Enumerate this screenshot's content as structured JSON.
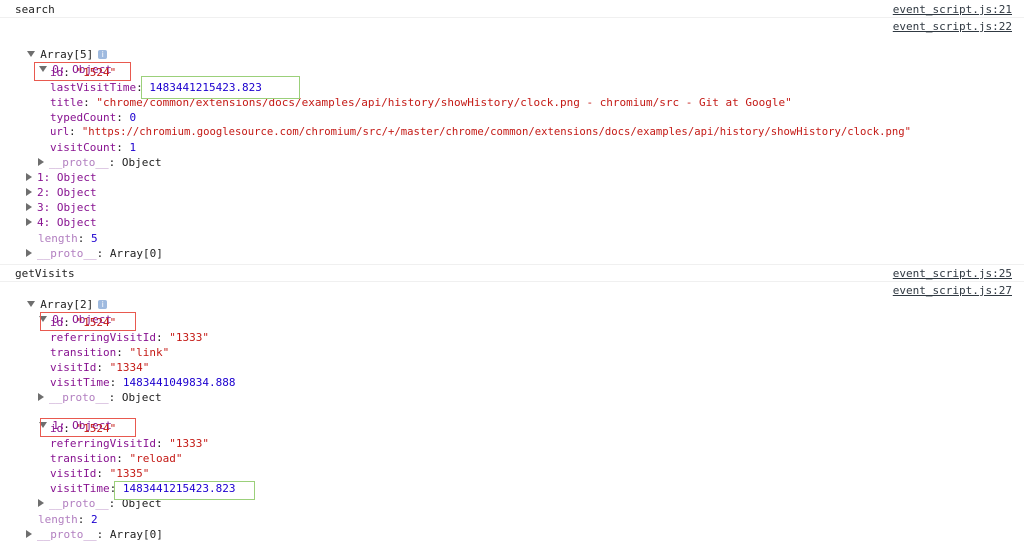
{
  "messages": [
    {
      "text": "search",
      "source": "event_script.js:21"
    },
    {
      "text": "getVisits",
      "source": "event_script.js:25"
    }
  ],
  "search_result": {
    "source": "event_script.js:22",
    "array_label": "Array[5]",
    "item0_label": "0: Object",
    "props": [
      {
        "key": "id",
        "value": "\"1524\"",
        "kind": "str"
      },
      {
        "key": "lastVisitTime",
        "value": "1483441215423.823",
        "kind": "num"
      },
      {
        "key": "title",
        "value": "\"chrome/common/extensions/docs/examples/api/history/showHistory/clock.png - chromium/src - Git at Google\"",
        "kind": "str"
      },
      {
        "key": "typedCount",
        "value": "0",
        "kind": "num"
      },
      {
        "key": "url",
        "value": "\"https://chromium.googlesource.com/chromium/src/+/master/chrome/common/extensions/docs/examples/api/history/showHistory/clock.png\"",
        "kind": "str"
      },
      {
        "key": "visitCount",
        "value": "1",
        "kind": "num"
      }
    ],
    "proto_key": "__proto__",
    "proto_value": "Object",
    "other_items": [
      "1: Object",
      "2: Object",
      "3: Object",
      "4: Object"
    ],
    "length_key": "length",
    "length_value": "5",
    "array_proto_value": "Array[0]"
  },
  "visits_result": {
    "source": "event_script.js:27",
    "array_label": "Array[2]",
    "item0_label": "0: Object",
    "item0_props": [
      {
        "key": "id",
        "value": "\"1524\""
      },
      {
        "key": "referringVisitId",
        "value": "\"1333\""
      },
      {
        "key": "transition",
        "value": "\"link\""
      },
      {
        "key": "visitId",
        "value": "\"1334\""
      },
      {
        "key": "visitTime",
        "value": "1483441049834.888"
      }
    ],
    "item1_label": "1: Object",
    "item1_props": [
      {
        "key": "id",
        "value": "\"1524\""
      },
      {
        "key": "referringVisitId",
        "value": "\"1333\""
      },
      {
        "key": "transition",
        "value": "\"reload\""
      },
      {
        "key": "visitId",
        "value": "\"1335\""
      },
      {
        "key": "visitTime",
        "value": "1483441215423.823"
      }
    ],
    "proto_key": "__proto__",
    "proto_value": "Object",
    "length_key": "length",
    "length_value": "2",
    "array_proto_value": "Array[0]"
  },
  "info_badge": "i",
  "colors": {
    "key": "#881391",
    "string": "#c41a16",
    "number": "#1c00cf",
    "highlight_red": "#e8594f",
    "highlight_green": "#9bd07a"
  }
}
